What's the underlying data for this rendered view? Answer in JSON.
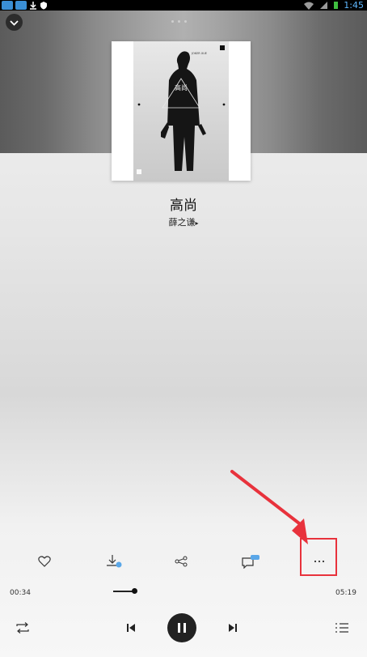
{
  "status_bar": {
    "time": "1:45"
  },
  "song": {
    "title": "高尚",
    "artist": "薛之谦"
  },
  "album_art_text": {
    "main": "高尚",
    "sub": "JOKER XUE"
  },
  "player": {
    "elapsed": "00:34",
    "duration": "05:19",
    "progress": 0.107
  },
  "colors": {
    "highlight": "#e8323c",
    "dark": "#222222"
  }
}
